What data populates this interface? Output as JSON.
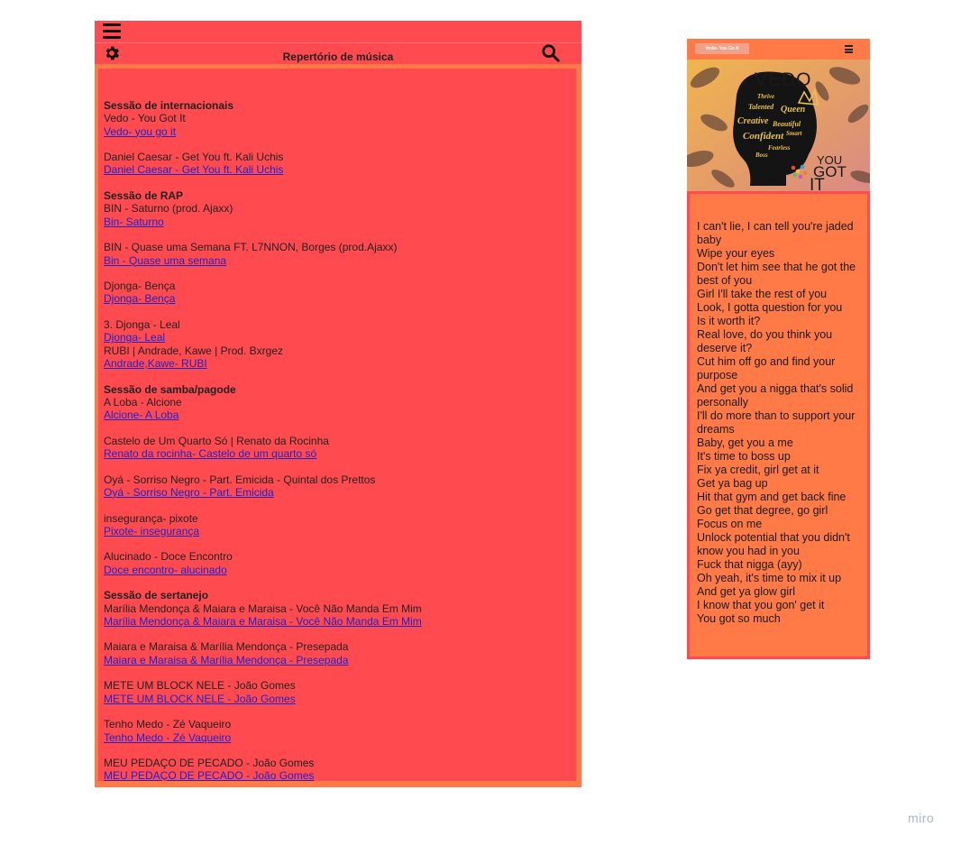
{
  "left": {
    "title": "Repertório de música",
    "sections": [
      {
        "title": "Sessão de internacionais",
        "songs": [
          {
            "name": "Vedo - You Got It",
            "link": "Vedo- you go it"
          },
          {
            "name": "Daniel Caesar - Get You ft. Kali Uchis",
            "link": "Daniel Caesar - Get You ft. Kali Uchis"
          }
        ]
      },
      {
        "title": "Sessão de RAP",
        "songs": [
          {
            "name": "BIN - Saturno (prod. Ajaxx)",
            "link": "Bin- Saturno"
          },
          {
            "name": "BIN - Quase uma Semana FT. L7NNON, Borges (prod.Ajaxx)",
            "link": "Bin - Quase uma semana"
          },
          {
            "name": "Djonga- Bença",
            "link": "Djonga- Bença"
          },
          {
            "name": "3. Djonga - Leal",
            "link": "Djonga- Leal"
          },
          {
            "name": "RUBI | Andrade, Kawe | Prod. Bxrgez",
            "link": "Andrade,Kawe- RUBI"
          }
        ]
      },
      {
        "title": "Sessão de samba/pagode",
        "songs": [
          {
            "name": "A Loba - Alcione",
            "link": "Alcione- A Loba"
          },
          {
            "name": "Castelo de Um Quarto Só | Renato da Rocinha",
            "link": "Renato da rocinha- Castelo de um quarto só"
          },
          {
            "name": "Oyá - Sorriso Negro - Part. Emicida - Quintal dos Prettos",
            "link": "Oyá - Sorriso Negro - Part. Emicida"
          },
          {
            "name": "insegurança- pixote",
            "link": "Pixote- insegurança"
          },
          {
            "name": "Alucinado - Doce Encontro",
            "link": "Doce encontro- alucinado"
          }
        ]
      },
      {
        "title": "Sessão de sertanejo",
        "songs": [
          {
            "name": "Marília Mendonça & Maiara e Maraisa - Você Não Manda Em Mim",
            "link": "Marília Mendonça & Maiara e Maraisa - Você Não Manda Em Mim"
          },
          {
            "name": "Maiara e Maraisa & Marília Mendonça - Presepada",
            "link": "Maiara e Maraisa & Marília Mendonça - Presepada"
          },
          {
            "name": "METE UM BLOCK NELE - João Gomes",
            "link": "METE UM BLOCK NELE - João Gomes"
          },
          {
            "name": "Tenho Medo - Zé Vaqueiro",
            "link": "Tenho Medo - Zé Vaqueiro"
          },
          {
            "name": "MEU PEDAÇO DE PECADO - João Gomes",
            "link": "MEU PEDAÇO DE PECADO - João Gomes"
          }
        ]
      }
    ]
  },
  "right": {
    "chip_label": "Vedo- You Go It",
    "cover": {
      "title": "VEDO",
      "subtitle_lines": [
        "YOU",
        "GOT",
        "IT"
      ],
      "words": [
        "Thrive",
        "Talented",
        "Queen",
        "Creative",
        "Beautiful",
        "Confident",
        "Smart",
        "Fearless",
        "Boss"
      ]
    },
    "lyrics": [
      "I can't lie, I can tell you're jaded baby",
      "Wipe your eyes",
      "Don't let him see that he got the best of you",
      "Girl I'll take the rest of you",
      "Look, I gotta question for you",
      "Is it worth it?",
      "Real love, do you think you deserve it?",
      "Cut him off go and find your purpose",
      "And get you a nigga that's solid personally",
      "I'll do more than to support your dreams",
      "Baby, get you a me",
      "It's time to boss up",
      "Fix ya credit, girl get at it",
      "Get ya bag up",
      "Hit that gym and get back fine",
      "Go get that degree, go girl",
      "Focus on me",
      "Unlock potential that you didn't know you had in you",
      "Fuck that nigga (ayy)",
      "Oh yeah, it's time to mix it up",
      "And get ya glow girl",
      "I know that you gon' get it",
      "You got so much"
    ]
  },
  "watermark": "miro",
  "colors": {
    "red": "#ff4a4f",
    "orange": "#ff7a47",
    "link": "#2222cc"
  }
}
